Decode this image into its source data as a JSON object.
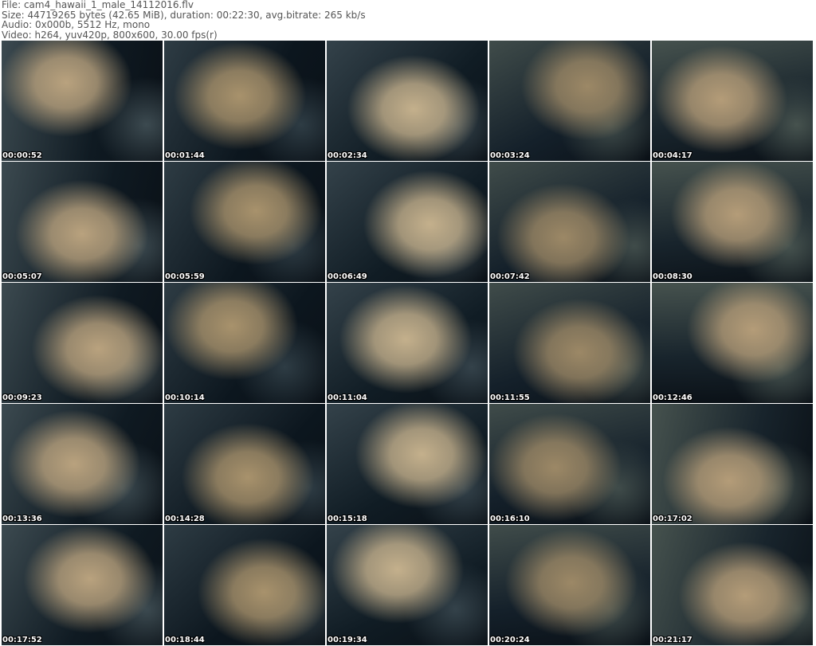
{
  "header": {
    "file": "File: cam4_hawaii_1_male_14112016.flv",
    "size": "Size: 44719265 bytes (42.65 MiB), duration: 00:22:30, avg.bitrate: 265 kb/s",
    "audio": "Audio: 0x000b, 5512 Hz, mono",
    "video": "Video: h264, yuv420p, 800x600, 30.00 fps(r)"
  },
  "thumbnails": [
    "00:00:52",
    "00:01:44",
    "00:02:34",
    "00:03:24",
    "00:04:17",
    "00:05:07",
    "00:05:59",
    "00:06:49",
    "00:07:42",
    "00:08:30",
    "00:09:23",
    "00:10:14",
    "00:11:04",
    "00:11:55",
    "00:12:46",
    "00:13:36",
    "00:14:28",
    "00:15:18",
    "00:16:10",
    "00:17:02",
    "00:17:52",
    "00:18:44",
    "00:19:34",
    "00:20:24",
    "00:21:17"
  ]
}
